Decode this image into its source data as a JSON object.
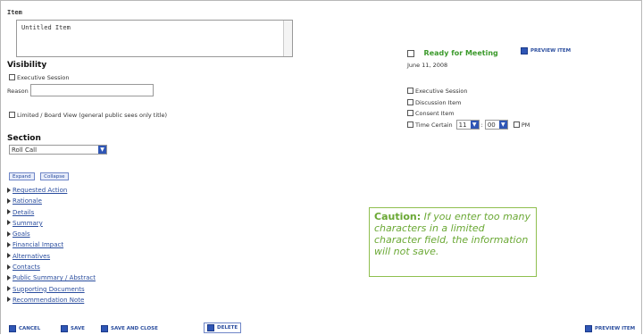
{
  "item": {
    "label": "Item",
    "title_value": "Untitled Item"
  },
  "visibility": {
    "label": "Visibility",
    "executive_session": "Executive Session",
    "reason_label": "Reason",
    "limited_view": "Limited / Board View (general public sees only title)"
  },
  "section": {
    "label": "Section",
    "selected": "Roll Call"
  },
  "expand_collapse": {
    "expand": "Expand",
    "collapse": "Collapse"
  },
  "sections_list": [
    "Requested Action",
    "Rationale",
    "Details",
    "Summary",
    "Goals",
    "Financial Impact",
    "Alternatives",
    "Contacts",
    "Public Summary / Abstract",
    "Supporting Documents",
    "Recommendation Note"
  ],
  "right_panel": {
    "ready_for_meeting": "Ready for Meeting",
    "preview_item": "PREVIEW ITEM",
    "date": "June 11, 2008",
    "options": [
      "Executive Session",
      "Discussion Item",
      "Consent Item",
      "Time Certain"
    ],
    "hour": "11",
    "minute": "00",
    "ampm": "PM"
  },
  "caution": {
    "title": "Caution:",
    "text": "If you enter too many characters in a limited character field, the information will not save."
  },
  "bottom_bar": {
    "cancel": "CANCEL",
    "save": "SAVE",
    "save_and_close": "SAVE AND CLOSE",
    "delete": "DELETE",
    "preview_item": "PREVIEW ITEM"
  },
  "colors": {
    "accent": "#2f56b5",
    "caution_green": "#6aa834",
    "ready_green": "#3c9a2c"
  }
}
